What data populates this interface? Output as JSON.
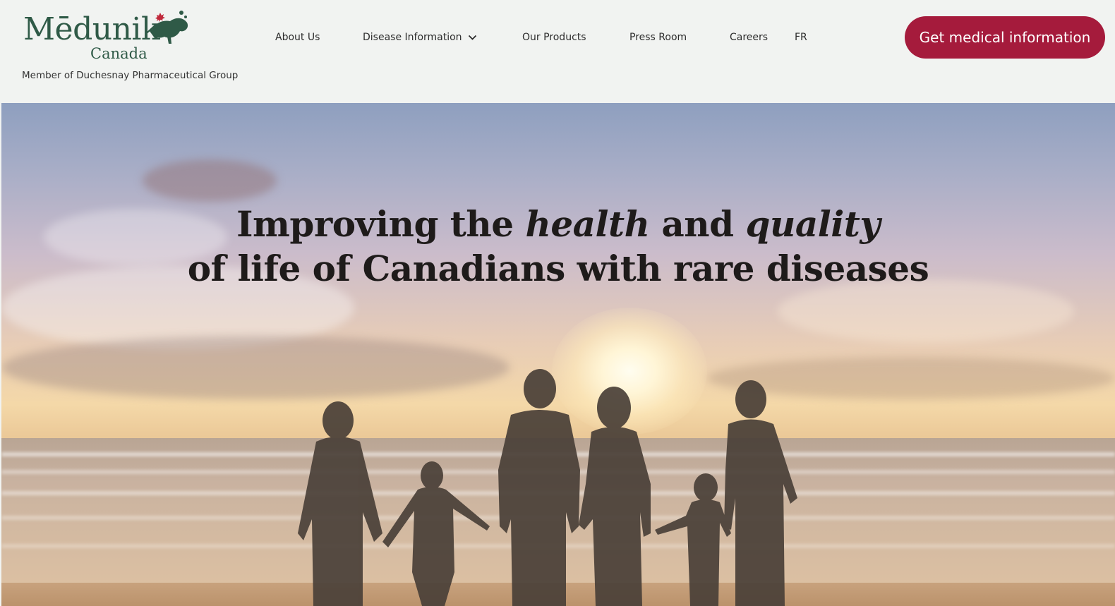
{
  "brand": {
    "wordmark": "Mēdunik",
    "sub": "Canada",
    "tagline": "Member of Duchesnay Pharmaceutical Group",
    "color": "#2f5a47"
  },
  "nav": {
    "items": [
      {
        "label": "About Us"
      },
      {
        "label": "Disease Information",
        "icon": "chevron-down-icon"
      },
      {
        "label": "Our Products"
      },
      {
        "label": "Press Room"
      },
      {
        "label": "Careers"
      },
      {
        "label": "FR"
      }
    ]
  },
  "cta": {
    "label": "Get medical information",
    "color": "#a51b3c"
  },
  "hero": {
    "line1_a": "Improving the ",
    "line1_b": "health",
    "line1_c": " and ",
    "line1_d": "quality",
    "line2": "of life of Canadians with rare diseases"
  }
}
